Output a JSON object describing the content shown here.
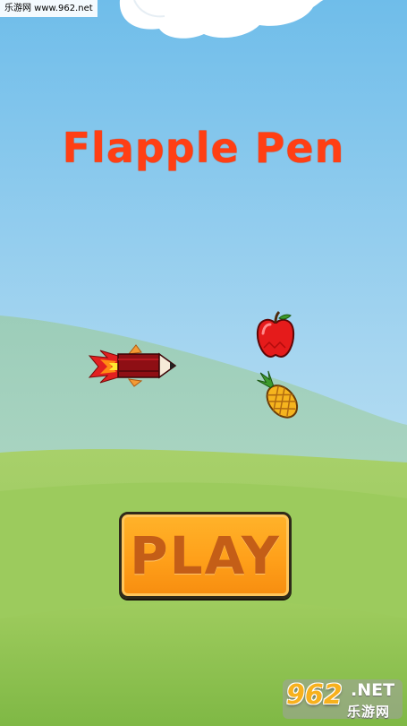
{
  "watermark": {
    "text": "乐游网 www.962.net"
  },
  "game": {
    "title": "Flapple Pen",
    "play_label": "PLAY"
  },
  "logo": {
    "number": "962",
    "net": ".NET",
    "site": "乐游网"
  },
  "icons": [
    "cloud-icon",
    "pen-rocket-icon",
    "apple-icon",
    "pineapple-icon"
  ],
  "colors": {
    "sky_top": "#6fbdea",
    "sky_bottom": "#d3ebf5",
    "title": "#ff3f14",
    "play_button": "#ffa01a",
    "play_text": "#c45e17",
    "grass": "#88c24e"
  }
}
